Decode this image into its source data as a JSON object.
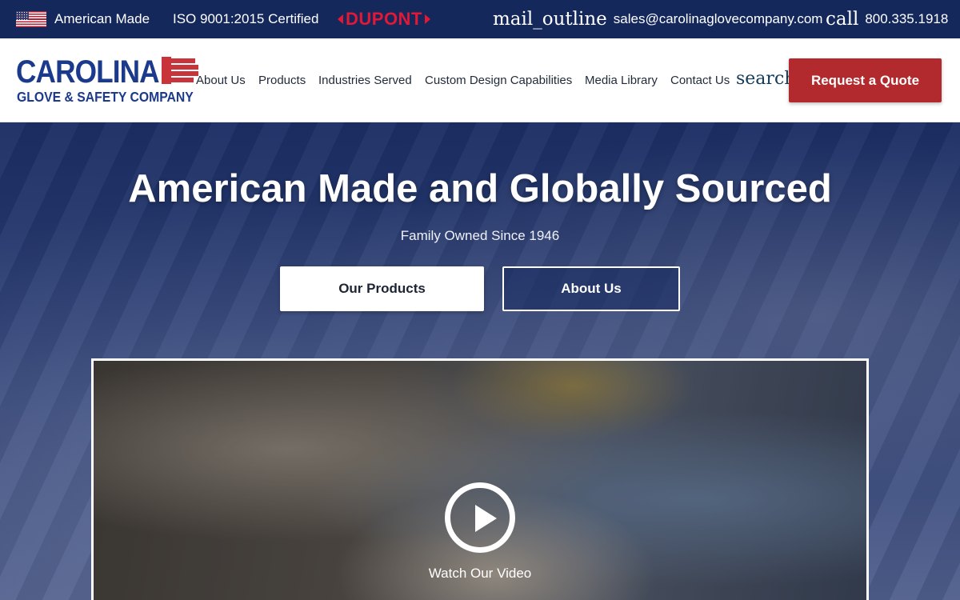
{
  "topbar": {
    "american_made": "American Made",
    "certification": "ISO 9001:2015 Certified",
    "partner_logo": "DUPONT",
    "email_icon": "mail_outline",
    "email": "sales@carolinaglovecompany.com",
    "phone_icon": "call",
    "phone": "800.335.1918",
    "background_color": "#14285c"
  },
  "header": {
    "logo": {
      "line1": "CAROLINA",
      "line2": "GLOVE & SAFETY COMPANY",
      "brand_color": "#1b3a8c",
      "accent_color": "#c9343a"
    },
    "nav": [
      {
        "label": "About Us"
      },
      {
        "label": "Products"
      },
      {
        "label": "Industries Served"
      },
      {
        "label": "Custom Design Capabilities"
      },
      {
        "label": "Media Library"
      },
      {
        "label": "Contact Us"
      }
    ],
    "search_icon": "search",
    "cta_label": "Request a Quote",
    "cta_color": "#b22a2e"
  },
  "hero": {
    "title": "American Made and Globally Sourced",
    "subtitle": "Family Owned Since 1946",
    "primary_button": "Our Products",
    "secondary_button": "About Us"
  },
  "video": {
    "label": "Watch Our Video",
    "play_icon": "play-circle-icon"
  }
}
